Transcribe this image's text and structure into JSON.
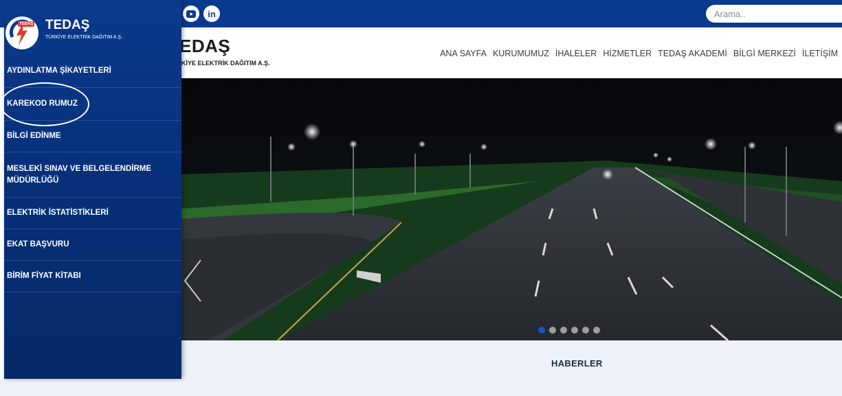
{
  "topbar": {
    "social": [
      {
        "icon": "youtube-icon",
        "glyph": "▶"
      },
      {
        "icon": "linkedin-icon",
        "glyph": "in"
      }
    ],
    "search_placeholder": "Arama.."
  },
  "header": {
    "brand_title": "EDAŞ",
    "brand_subtitle": "KİYE ELEKTRİK DAĞITIM A.Ş.",
    "nav": [
      "ANA SAYFA",
      "KURUMUMUZ",
      "İHALELER",
      "HİZMETLER",
      "TEDAŞ AKADEMİ",
      "BİLGİ MERKEZİ",
      "İLETİŞİM"
    ]
  },
  "hero": {
    "slide_count": 6,
    "active_slide": 1
  },
  "news": {
    "title": "HABERLER"
  },
  "sidebar": {
    "logo_tag": "TEDAŞ",
    "logo_title": "TEDAŞ",
    "logo_subtitle": "TÜRKİYE ELEKTRİK DAĞITIM A.Ş.",
    "items": [
      {
        "label": "AYDINLATMA ŞİKAYETLERİ"
      },
      {
        "label": "KAREKOD RUMUZ"
      },
      {
        "label": "BİLGİ EDİNME"
      },
      {
        "label": "MESLEKİ SINAV VE BELGELENDİRME MÜDÜRLÜĞÜ"
      },
      {
        "label": "ELEKTRİK İSTATİSTİKLERİ"
      },
      {
        "label": "EKAT BAŞVURU"
      },
      {
        "label": "BİRİM FİYAT KİTABI"
      }
    ]
  },
  "colors": {
    "topbar": "#0a3a8f",
    "sidebar": "#07307a",
    "news_band": "#eef2f8",
    "active_dot": "#1554c8"
  }
}
